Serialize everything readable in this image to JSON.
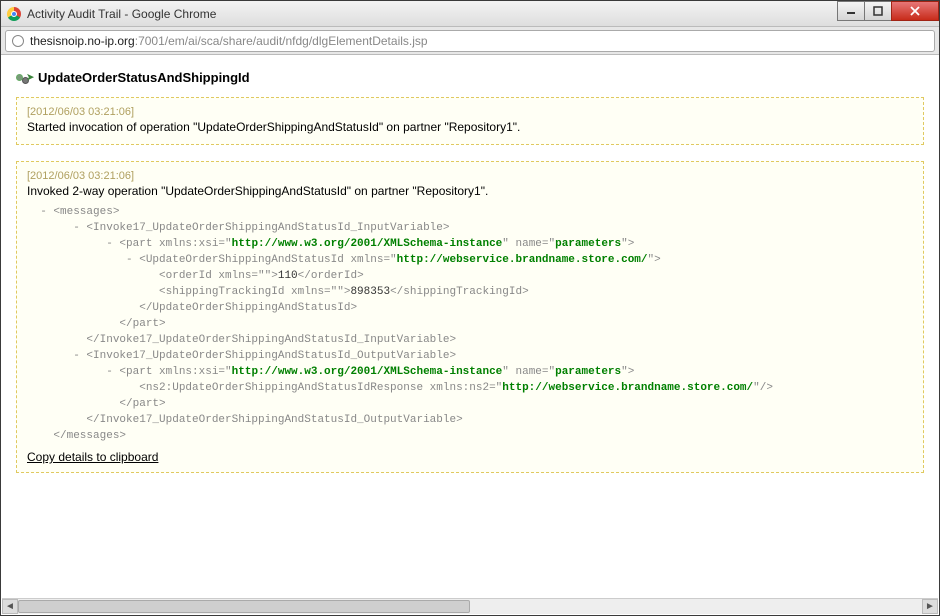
{
  "window": {
    "title": "Activity Audit Trail - Google Chrome",
    "url_host": "thesisnoip.no-ip.org",
    "url_path": ":7001/em/ai/sca/share/audit/nfdg/dlgElementDetails.jsp"
  },
  "page": {
    "heading": "UpdateOrderStatusAndShippingId"
  },
  "audits": [
    {
      "timestamp": "[2012/06/03 03:21:06]",
      "message": "Started invocation of operation \"UpdateOrderShippingAndStatusId\" on partner \"Repository1\"."
    },
    {
      "timestamp": "[2012/06/03 03:21:06]",
      "message": "Invoked 2-way operation \"UpdateOrderShippingAndStatusId\" on partner \"Repository1\"."
    }
  ],
  "xml": {
    "l01": "  - <messages>",
    "l02a": "       - <Invoke17_UpdateOrderShippingAndStatusId_InputVariable>",
    "l03_pre": "            - <part xmlns:xsi=\"",
    "l03_url": "http://www.w3.org/2001/XMLSchema-instance",
    "l03_mid": "\" name=\"",
    "l03_name": "parameters",
    "l03_post": "\">",
    "l04_pre": "               - <UpdateOrderShippingAndStatusId xmlns=\"",
    "l04_url": "http://webservice.brandname.store.com/",
    "l04_post": "\">",
    "l05_pre": "                    <orderId xmlns=\"\">",
    "l05_val": "110",
    "l05_post": "</orderId>",
    "l06_pre": "                    <shippingTrackingId xmlns=\"\">",
    "l06_val": "898353",
    "l06_post": "</shippingTrackingId>",
    "l07": "                 </UpdateOrderShippingAndStatusId>",
    "l08": "              </part>",
    "l09": "         </Invoke17_UpdateOrderShippingAndStatusId_InputVariable>",
    "l10": "       - <Invoke17_UpdateOrderShippingAndStatusId_OutputVariable>",
    "l11_pre": "            - <part xmlns:xsi=\"",
    "l11_url": "http://www.w3.org/2001/XMLSchema-instance",
    "l11_mid": "\" name=\"",
    "l11_name": "parameters",
    "l11_post": "\">",
    "l12_pre": "                 <ns2:UpdateOrderShippingAndStatusIdResponse xmlns:ns2=\"",
    "l12_url": "http://webservice.brandname.store.com/",
    "l12_post": "\"/>",
    "l13": "              </part>",
    "l14": "         </Invoke17_UpdateOrderShippingAndStatusId_OutputVariable>",
    "l15": "    </messages>"
  },
  "links": {
    "copy": "Copy details to clipboard"
  }
}
